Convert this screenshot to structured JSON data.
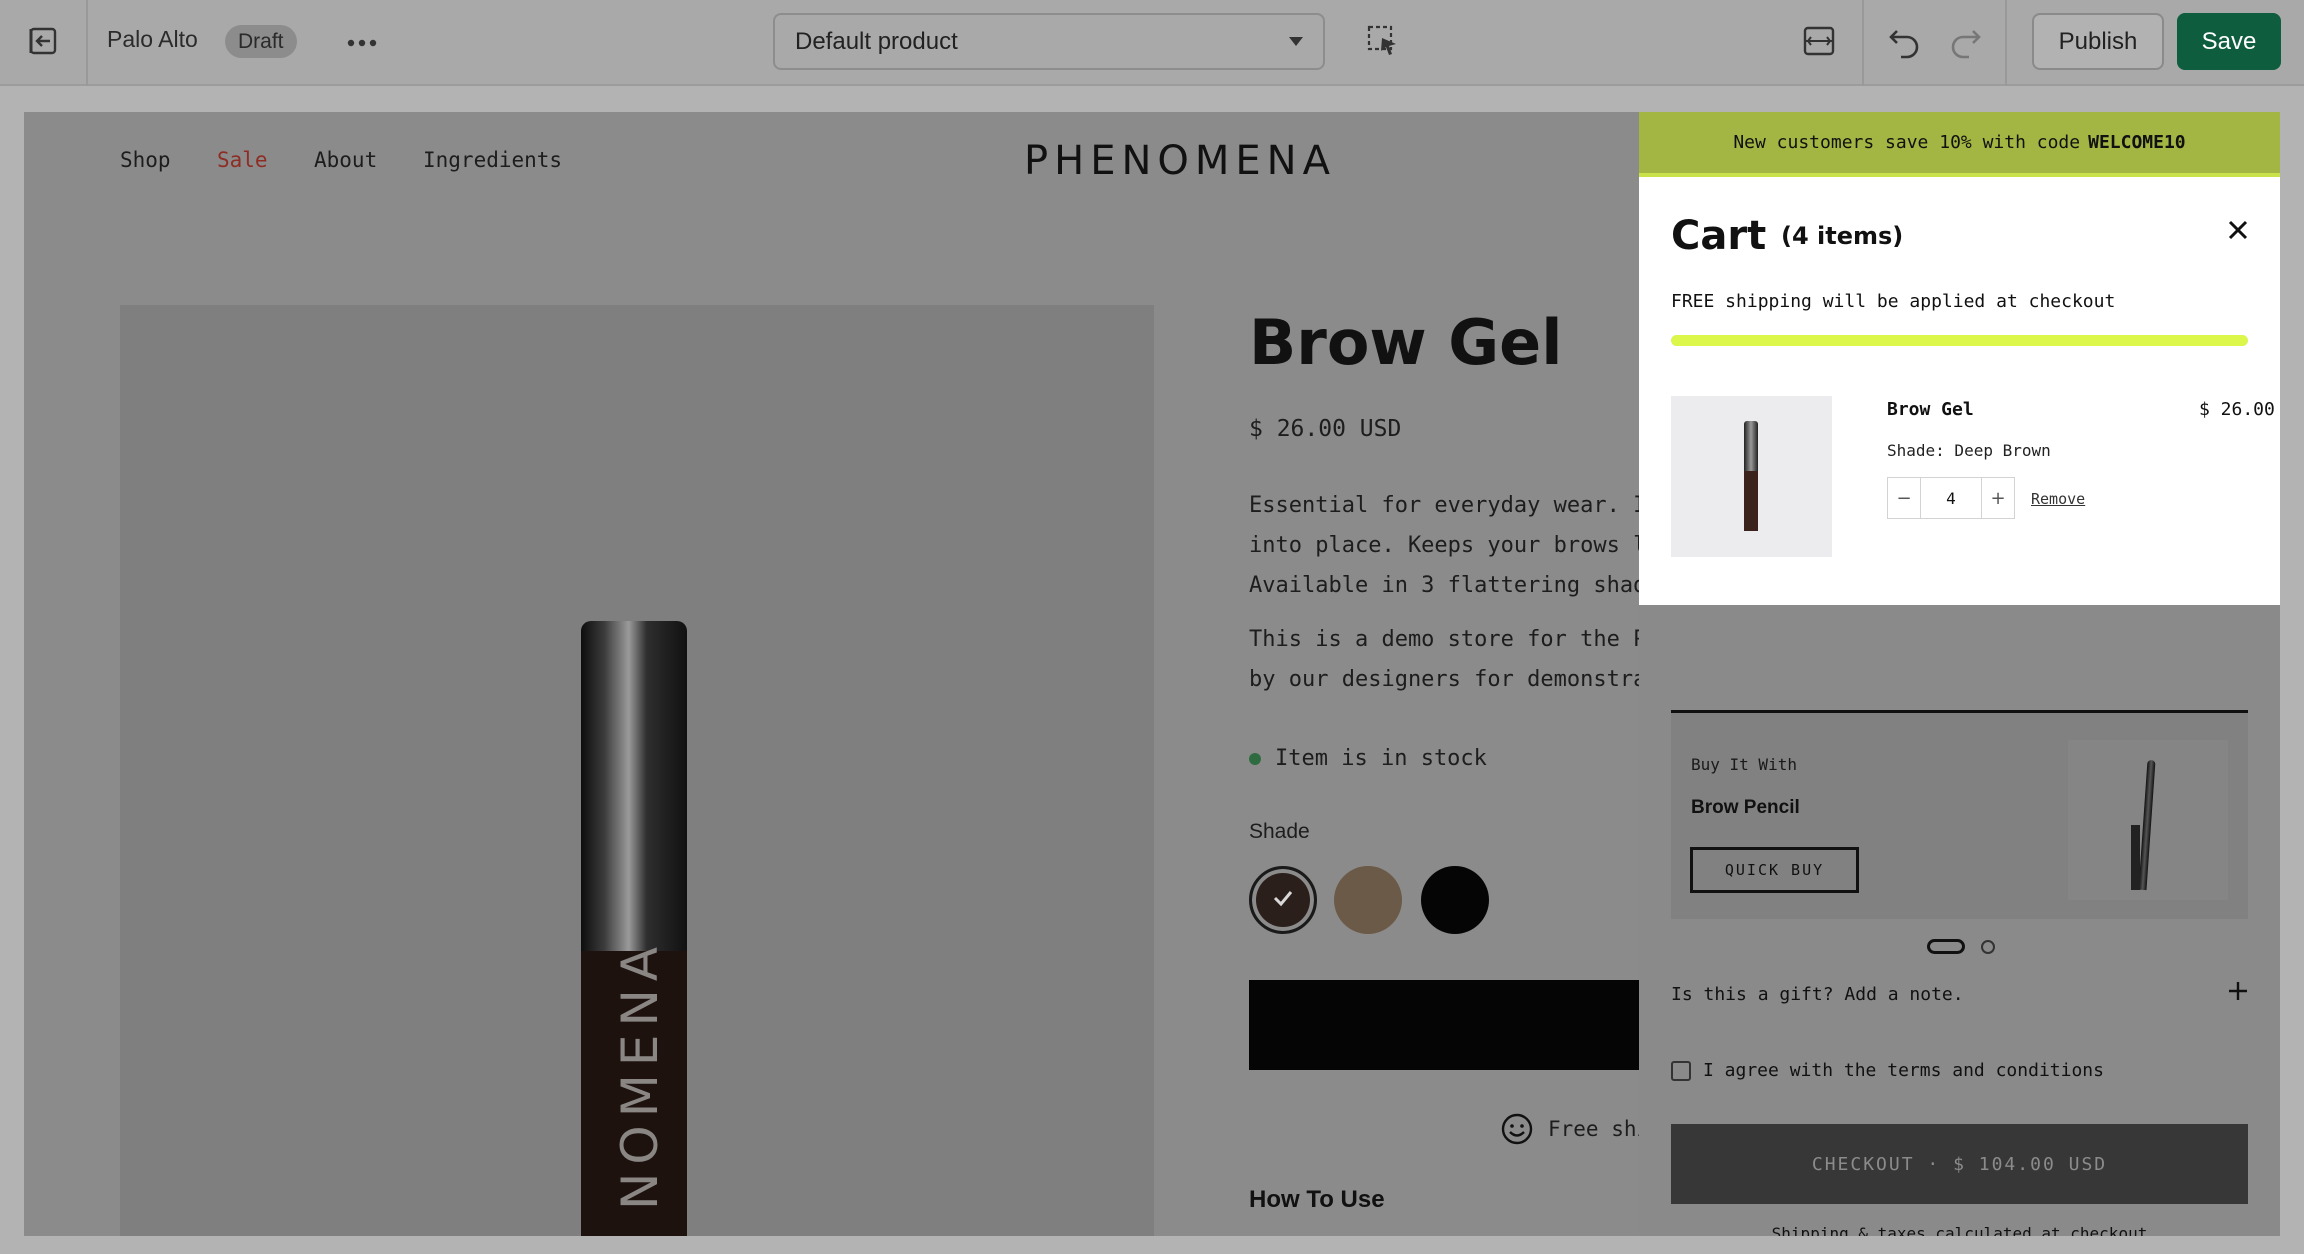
{
  "toolbar": {
    "theme_name": "Palo Alto",
    "status_badge": "Draft",
    "template_select": "Default product",
    "publish_label": "Publish",
    "save_label": "Save",
    "colors": {
      "save_bg": "#0e5d3f"
    }
  },
  "store": {
    "nav": [
      "Shop",
      "Sale",
      "About",
      "Ingredients"
    ],
    "logo": "PHENOMENA",
    "product": {
      "title": "Brow Gel",
      "price": "$ 26.00 USD",
      "description_lines": [
        "Essential for everyday wear. In",
        "into place. Keeps your brows lo",
        "Available in 3 flattering shade"
      ],
      "demo_lines": [
        "This is a demo store for the Pa",
        "by our designers for demonstrat"
      ],
      "stock": "Item is in stock",
      "shade_label": "Shade",
      "shades": [
        "#2b1f1b",
        "#6b5a47",
        "#050505"
      ],
      "free_shipping": "Free shi",
      "how_to": "How To Use",
      "image_text": "NOMENA"
    }
  },
  "cart": {
    "announcement": "New customers save 10% with code",
    "announcement_code": "WELCOME10",
    "title": "Cart",
    "count": "(4 items)",
    "shipping_note": "FREE shipping will be applied at checkout",
    "shipping_progress": 1.0,
    "item": {
      "name": "Brow Gel",
      "price": "$ 26.00",
      "shade": "Shade: Deep Brown",
      "quantity": "4",
      "remove": "Remove"
    },
    "upsell": {
      "heading": "Buy It With",
      "name": "Brow Pencil",
      "button": "QUICK BUY"
    },
    "gift_note": "Is this a gift? Add a note.",
    "terms": "I agree with the terms and conditions",
    "checkout": "CHECKOUT · $ 104.00 USD",
    "taxes": "Shipping & taxes calculated at checkout"
  }
}
